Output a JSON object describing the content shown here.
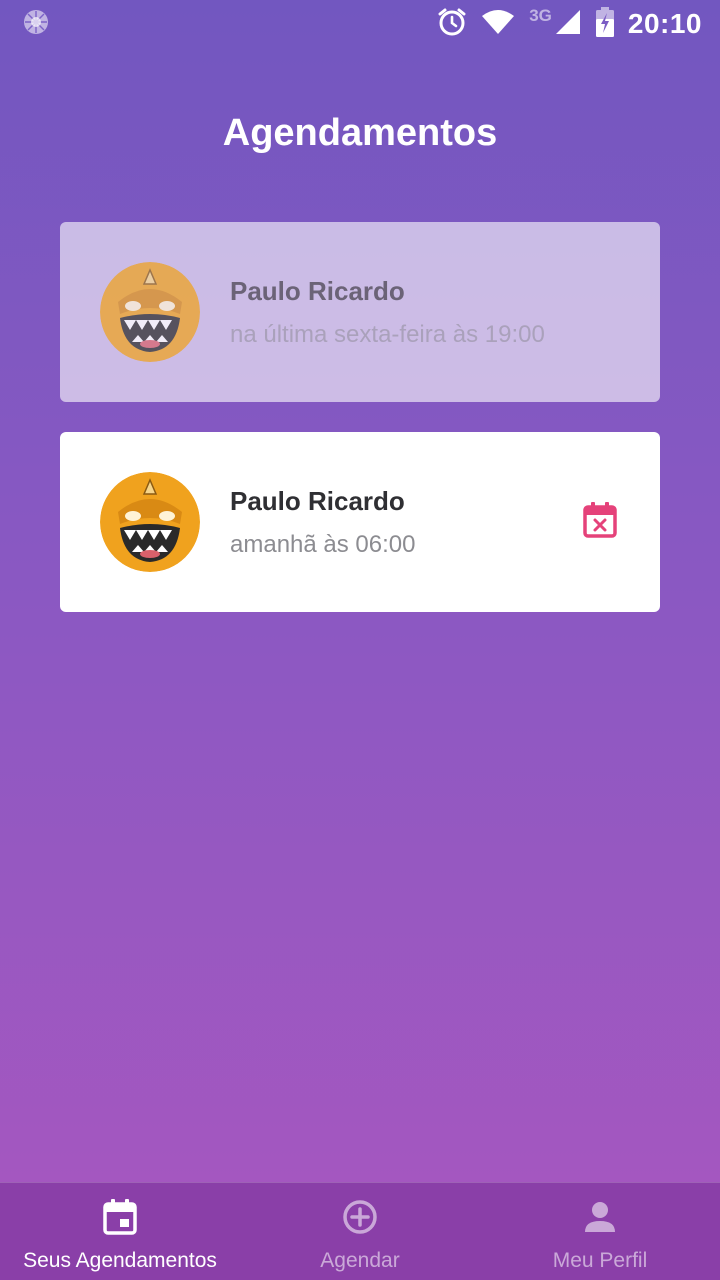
{
  "status_bar": {
    "time": "20:10",
    "network_label": "3G",
    "icons": [
      "loading-icon",
      "alarm-icon",
      "wifi-icon",
      "signal-icon",
      "battery-charging-icon"
    ]
  },
  "header": {
    "title": "Agendamentos"
  },
  "appointments": [
    {
      "name": "Paulo Ricardo",
      "time": "na última sexta-feira às 19:00",
      "state": "past"
    },
    {
      "name": "Paulo Ricardo",
      "time": "amanhã às 06:00",
      "state": "upcoming",
      "action_icon": "calendar-remove-icon"
    }
  ],
  "tabs": [
    {
      "label": "Seus Agendamentos",
      "icon": "calendar-icon",
      "active": true
    },
    {
      "label": "Agendar",
      "icon": "add-circle-icon",
      "active": false
    },
    {
      "label": "Meu Perfil",
      "icon": "person-icon",
      "active": false
    }
  ],
  "colors": {
    "accent_cancel": "#e5427a",
    "tab_bar": "#8a3fa8",
    "background_top": "#7257c0",
    "background_bottom": "#a857c0"
  }
}
